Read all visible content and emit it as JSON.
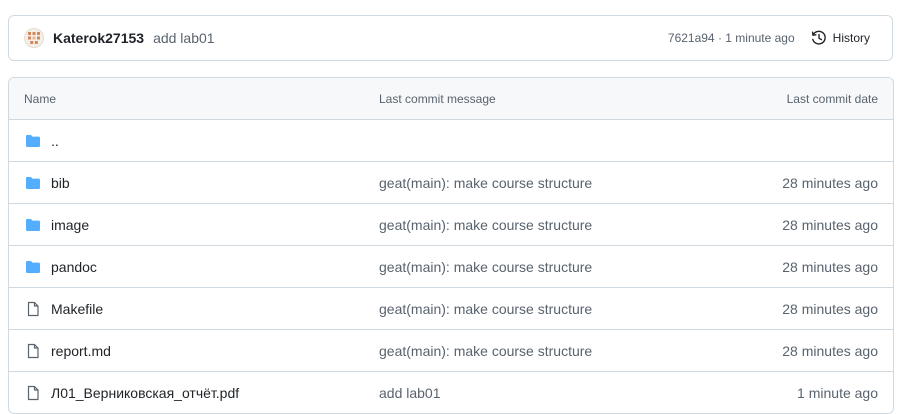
{
  "latest_commit": {
    "author": "Katerok27153",
    "message": "add lab01",
    "hash_and_time": "7621a94 · 1 minute ago",
    "history_label": "History"
  },
  "table": {
    "headers": {
      "name": "Name",
      "message": "Last commit message",
      "date": "Last commit date"
    },
    "rows": [
      {
        "type": "folder",
        "name": "..",
        "message": "",
        "date": ""
      },
      {
        "type": "folder",
        "name": "bib",
        "message": "geat(main): make course structure",
        "date": "28 minutes ago"
      },
      {
        "type": "folder",
        "name": "image",
        "message": "geat(main): make course structure",
        "date": "28 minutes ago"
      },
      {
        "type": "folder",
        "name": "pandoc",
        "message": "geat(main): make course structure",
        "date": "28 minutes ago"
      },
      {
        "type": "file",
        "name": "Makefile",
        "message": "geat(main): make course structure",
        "date": "28 minutes ago"
      },
      {
        "type": "file",
        "name": "report.md",
        "message": "geat(main): make course structure",
        "date": "28 minutes ago"
      },
      {
        "type": "file",
        "name": "Л01_Верниковская_отчёт.pdf",
        "message": "add lab01",
        "date": "1 minute ago"
      }
    ]
  },
  "icons": {
    "avatar": "identicon-avatar",
    "history": "history-icon",
    "folder": "folder-icon",
    "file": "file-icon"
  },
  "colors": {
    "folder": "#54aeff",
    "file_icon": "#59636e",
    "avatar_accent": "#d4875a",
    "border": "#d1d9e0",
    "header_bg": "#f6f8fa"
  }
}
